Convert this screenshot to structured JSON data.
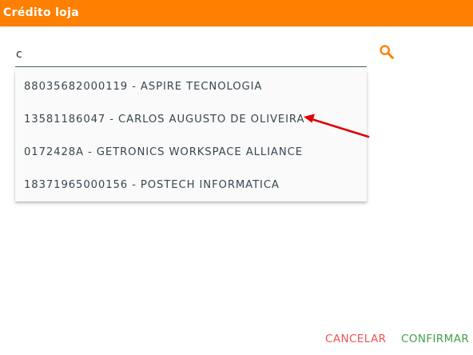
{
  "dialog": {
    "title": "Crédito loja"
  },
  "search": {
    "value": "c",
    "placeholder": ""
  },
  "dropdown": {
    "options": [
      {
        "label": "88035682000119 - ASPIRE TECNOLOGIA"
      },
      {
        "label": "13581186047 - CARLOS AUGUSTO DE OLIVEIRA"
      },
      {
        "label": "0172428A - GETRONICS WORKSPACE ALLIANCE"
      },
      {
        "label": "18371965000156 - POSTECH INFORMATICA"
      }
    ]
  },
  "actions": {
    "cancel_label": "CANCELAR",
    "confirm_label": "CONFIRMAR"
  },
  "colors": {
    "header": "#ff8000",
    "search_icon": "#ff8000",
    "annotation_arrow": "#e00000",
    "cancel": "#ef5350",
    "confirm": "#43a047"
  },
  "icons": {
    "search": "search-icon",
    "annotation": "red-arrow-icon"
  }
}
